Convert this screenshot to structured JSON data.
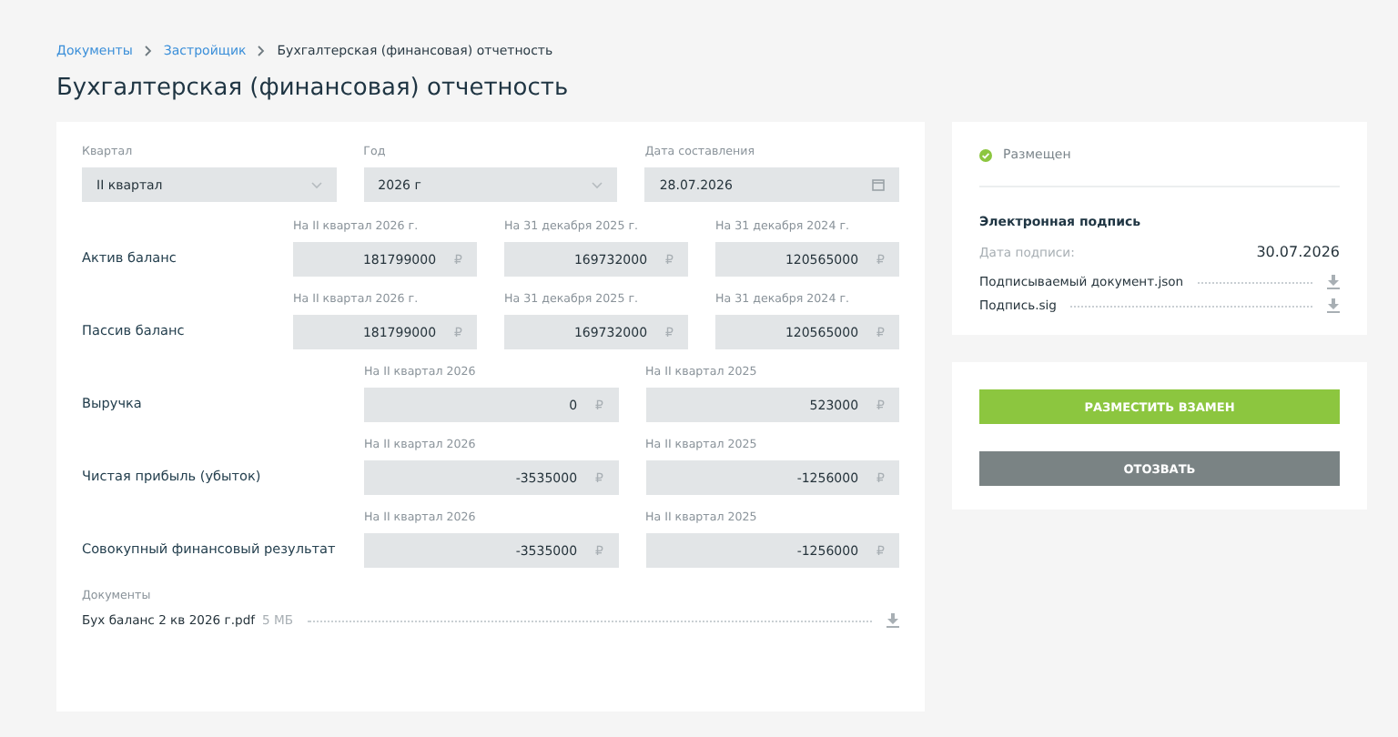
{
  "breadcrumbs": [
    {
      "label": "Документы",
      "link": true
    },
    {
      "label": "Застройщик",
      "link": true
    },
    {
      "label": "Бухгалтерская (финансовая) отчетность",
      "link": false
    }
  ],
  "title": "Бухгалтерская (финансовая) отчетность",
  "filters": [
    {
      "label": "Квартал",
      "value": "II квартал",
      "kind": "select"
    },
    {
      "label": "Год",
      "value": "2026 г",
      "kind": "select"
    },
    {
      "label": "Дата составления",
      "value": "28.07.2026",
      "kind": "date"
    }
  ],
  "rows": [
    {
      "label": "Актив баланс",
      "fields": [
        {
          "caption": "На II квартал 2026 г.",
          "value": "181799000",
          "currency": "₽"
        },
        {
          "caption": "На 31 декабря 2025 г.",
          "value": "169732000",
          "currency": "₽"
        },
        {
          "caption": "На 31 декабря 2024 г.",
          "value": "120565000",
          "currency": "₽"
        }
      ]
    },
    {
      "label": "Пассив баланс",
      "fields": [
        {
          "caption": "На II квартал 2026 г.",
          "value": "181799000",
          "currency": "₽"
        },
        {
          "caption": "На 31 декабря 2025 г.",
          "value": "169732000",
          "currency": "₽"
        },
        {
          "caption": "На 31 декабря 2024 г.",
          "value": "120565000",
          "currency": "₽"
        }
      ]
    },
    {
      "label": "Выручка",
      "fields": [
        {
          "caption": "На II квартал 2026",
          "value": "0",
          "currency": "₽"
        },
        {
          "caption": "На II квартал 2025",
          "value": "523000",
          "currency": "₽"
        }
      ]
    },
    {
      "label": "Чистая прибыль (убыток)",
      "fields": [
        {
          "caption": "На II квартал 2026",
          "value": "-3535000",
          "currency": "₽"
        },
        {
          "caption": "На II квартал 2025",
          "value": "-1256000",
          "currency": "₽"
        }
      ]
    },
    {
      "label": "Совокупный финансовый результат",
      "fields": [
        {
          "caption": "На II квартал 2026",
          "value": "-3535000",
          "currency": "₽"
        },
        {
          "caption": "На II квартал 2025",
          "value": "-1256000",
          "currency": "₽"
        }
      ]
    }
  ],
  "documents": {
    "label": "Документы",
    "files": [
      {
        "name": "Бух баланс 2 кв 2026 г.pdf",
        "size": "5 МБ"
      }
    ]
  },
  "status": {
    "label": "Размещен",
    "color": "#8cc63f"
  },
  "signature": {
    "title": "Электронная подпись",
    "date_label": "Дата подписи:",
    "date": "30.07.2026",
    "files": [
      {
        "name": "Подписываемый документ.json"
      },
      {
        "name": "Подпись.sig"
      }
    ]
  },
  "buttons": [
    {
      "label": "РАЗМЕСТИТЬ ВЗАМЕН",
      "kind": "primary"
    },
    {
      "label": "ОТОЗВАТЬ",
      "kind": "secondary"
    }
  ]
}
